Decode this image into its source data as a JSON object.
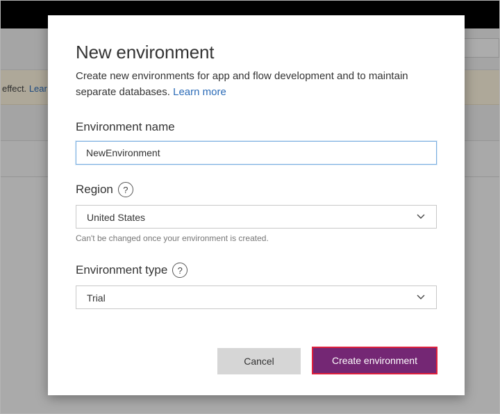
{
  "background": {
    "notice_text": "effect.",
    "notice_link": "Lear"
  },
  "dialog": {
    "title": "New environment",
    "description": "Create new environments for app and flow development and to maintain separate databases.",
    "learn_more": "Learn more",
    "environment_name": {
      "label": "Environment name",
      "value": "NewEnvironment"
    },
    "region": {
      "label": "Region",
      "help_icon": "?",
      "selected": "United States",
      "hint": "Can't be changed once your environment is created."
    },
    "environment_type": {
      "label": "Environment type",
      "help_icon": "?",
      "selected": "Trial"
    },
    "buttons": {
      "cancel": "Cancel",
      "create": "Create environment"
    }
  },
  "colors": {
    "primary_button": "#742774",
    "highlight_outline": "#e0203c",
    "link": "#2b6bb7",
    "input_focus_border": "#79aee0"
  }
}
